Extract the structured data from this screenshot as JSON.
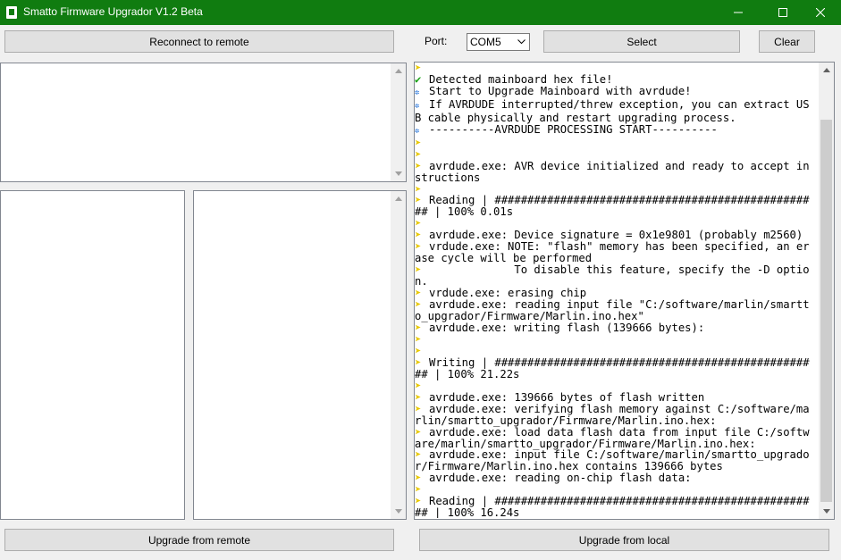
{
  "window": {
    "title": "Smatto Firmware Upgrador V1.2 Beta",
    "accent": "#107c10"
  },
  "toolbar": {
    "reconnect_label": "Reconnect to remote",
    "port_label": "Port:",
    "port_value": "COM5",
    "select_label": "Select",
    "clear_label": "Clear"
  },
  "bottom": {
    "upgrade_remote_label": "Upgrade from remote",
    "upgrade_local_label": "Upgrade from local"
  },
  "log": [
    {
      "icon": "arrow",
      "text": ""
    },
    {
      "icon": "check",
      "text": "Detected mainboard hex file!"
    },
    {
      "icon": "info",
      "text": "Start to Upgrade Mainboard with avrdude!"
    },
    {
      "icon": "info",
      "text": "If AVRDUDE interrupted/threw exception, you can extract USB cable physically and restart upgrading process."
    },
    {
      "icon": "info",
      "text": "----------AVRDUDE PROCESSING START----------"
    },
    {
      "icon": "arrow",
      "text": ""
    },
    {
      "icon": "arrow",
      "text": ""
    },
    {
      "icon": "arrow",
      "text": "avrdude.exe: AVR device initialized and ready to accept instructions"
    },
    {
      "icon": "arrow",
      "text": ""
    },
    {
      "icon": "arrow",
      "text": "Reading | ################################################## | 100% 0.01s"
    },
    {
      "icon": "arrow",
      "text": ""
    },
    {
      "icon": "arrow",
      "text": "avrdude.exe: Device signature = 0x1e9801 (probably m2560)"
    },
    {
      "icon": "arrow",
      "text": "vrdude.exe: NOTE: \"flash\" memory has been specified, an erase cycle will be performed"
    },
    {
      "icon": "arrow",
      "text": "             To disable this feature, specify the -D option."
    },
    {
      "icon": "arrow",
      "text": "vrdude.exe: erasing chip"
    },
    {
      "icon": "arrow",
      "text": "avrdude.exe: reading input file \"C:/software/marlin/smartto_upgrador/Firmware/Marlin.ino.hex\""
    },
    {
      "icon": "arrow",
      "text": "avrdude.exe: writing flash (139666 bytes):"
    },
    {
      "icon": "arrow",
      "text": ""
    },
    {
      "icon": "arrow",
      "text": ""
    },
    {
      "icon": "arrow",
      "text": "Writing | ################################################## | 100% 21.22s"
    },
    {
      "icon": "arrow",
      "text": ""
    },
    {
      "icon": "arrow",
      "text": "avrdude.exe: 139666 bytes of flash written"
    },
    {
      "icon": "arrow",
      "text": "avrdude.exe: verifying flash memory against C:/software/marlin/smartto_upgrador/Firmware/Marlin.ino.hex:"
    },
    {
      "icon": "arrow",
      "text": "avrdude.exe: load data flash data from input file C:/software/marlin/smartto_upgrador/Firmware/Marlin.ino.hex:"
    },
    {
      "icon": "arrow",
      "text": "avrdude.exe: input file C:/software/marlin/smartto_upgrador/Firmware/Marlin.ino.hex contains 139666 bytes"
    },
    {
      "icon": "arrow",
      "text": "avrdude.exe: reading on-chip flash data:"
    },
    {
      "icon": "arrow",
      "text": ""
    },
    {
      "icon": "arrow",
      "text": "Reading | ################################################## | 100% 16.24s"
    },
    {
      "icon": "arrow",
      "text": ""
    },
    {
      "icon": "arrow",
      "text": ""
    }
  ],
  "icons": {
    "check": "✔",
    "info": "✲",
    "arrow": "➤"
  }
}
